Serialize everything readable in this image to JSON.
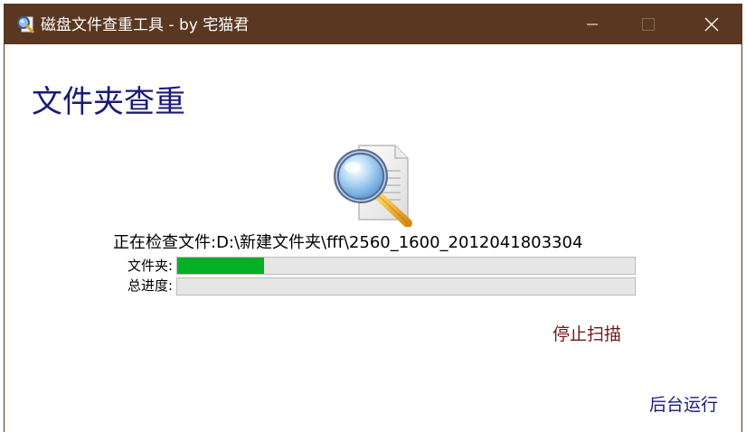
{
  "window": {
    "title": "磁盘文件查重工具 - by 宅猫君",
    "titlebar_color": "#5a3720"
  },
  "header": {
    "title": "文件夹查重"
  },
  "scan": {
    "icon": "magnifier-document-icon",
    "status": "正在检查文件:D:\\新建文件夹\\fff\\2560_1600_2012041803304",
    "folder_label": "文件夹:",
    "folder_progress": 0.19,
    "total_label": "总进度:",
    "total_progress": 0.0,
    "progress_color": "#06b025"
  },
  "actions": {
    "stop_label": "停止扫描",
    "background_label": "后台运行"
  }
}
